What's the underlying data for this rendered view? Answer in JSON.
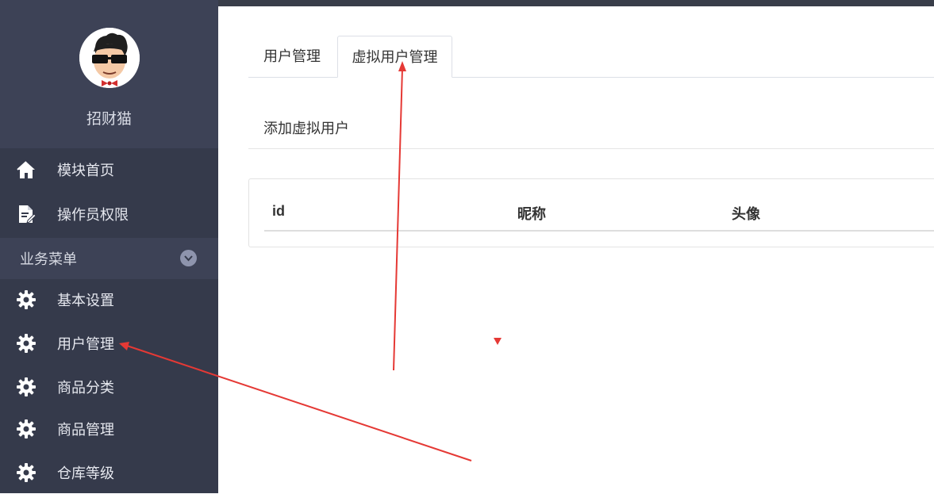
{
  "sidebar": {
    "username": "招财猫",
    "avatar": "cartoon-sunglasses-avatar",
    "items_top": [
      {
        "label": "模块首页",
        "icon": "home-icon"
      },
      {
        "label": "操作员权限",
        "icon": "document-edit-icon"
      }
    ],
    "group": {
      "label": "业务菜单",
      "icon": "chevron-down-icon"
    },
    "items_group": [
      {
        "label": "基本设置",
        "icon": "gear-icon"
      },
      {
        "label": "用户管理",
        "icon": "gear-icon"
      },
      {
        "label": "商品分类",
        "icon": "gear-icon"
      },
      {
        "label": "商品管理",
        "icon": "gear-icon"
      },
      {
        "label": "仓库等级",
        "icon": "gear-icon"
      }
    ]
  },
  "main": {
    "tabs": [
      {
        "label": "用户管理",
        "active": false
      },
      {
        "label": "虚拟用户管理",
        "active": true
      }
    ],
    "add_link": "添加虚拟用户",
    "table": {
      "headers": [
        "id",
        "昵称",
        "头像"
      ],
      "rows": []
    }
  },
  "colors": {
    "sidebar_bg": "#353a4b",
    "sidebar_header_bg": "#3d4256",
    "annotation_red": "#e53935"
  }
}
